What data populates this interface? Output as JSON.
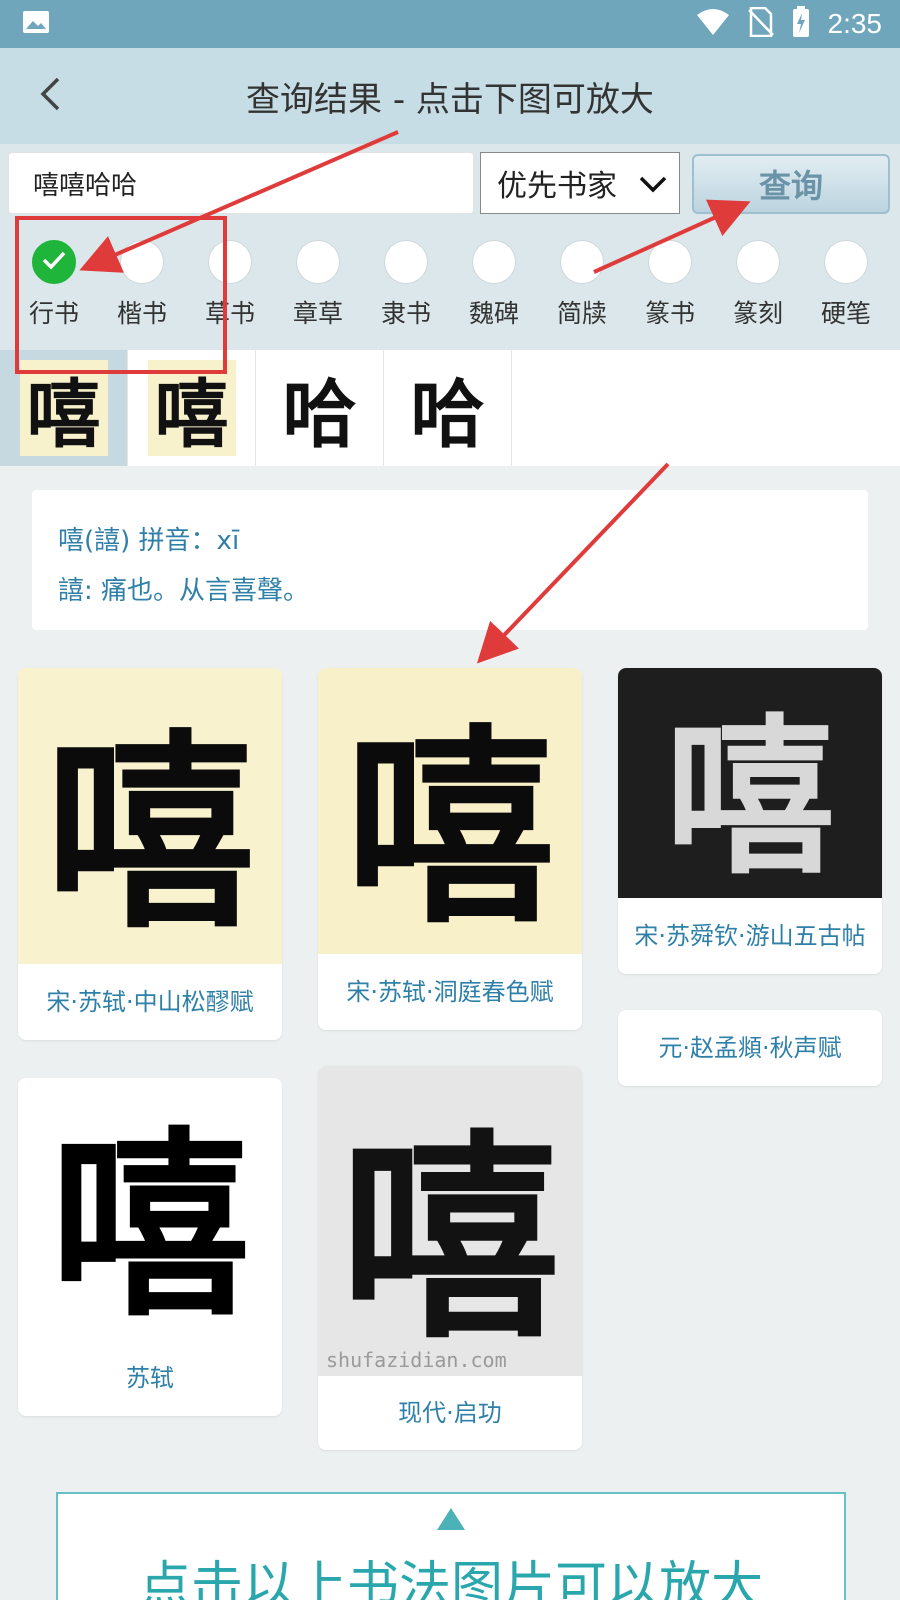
{
  "status_bar": {
    "time": "2:35",
    "icons": [
      "image-icon",
      "wifi-icon",
      "no-sim-icon",
      "battery-charging-icon"
    ]
  },
  "title_bar": {
    "title": "查询结果 - 点击下图可放大"
  },
  "search": {
    "value": "嘻嘻哈哈",
    "select_value": "优先书家",
    "button_label": "查询"
  },
  "styles": [
    {
      "label": "行书",
      "checked": true
    },
    {
      "label": "楷书",
      "checked": false
    },
    {
      "label": "草书",
      "checked": false
    },
    {
      "label": "章草",
      "checked": false
    },
    {
      "label": "隶书",
      "checked": false
    },
    {
      "label": "魏碑",
      "checked": false
    },
    {
      "label": "简牍",
      "checked": false
    },
    {
      "label": "篆书",
      "checked": false
    },
    {
      "label": "篆刻",
      "checked": false
    },
    {
      "label": "硬笔",
      "checked": false
    }
  ],
  "thumbnails": [
    {
      "char": "嘻",
      "selected": true
    },
    {
      "char": "嘻",
      "selected": false
    },
    {
      "char": "哈",
      "selected": false
    },
    {
      "char": "哈",
      "selected": false
    }
  ],
  "info": {
    "line1": "嘻(譆)    拼音：xī",
    "line2": "譆: 痛也。从言喜聲。"
  },
  "cards": [
    {
      "glyph": "嘻",
      "caption": "宋·苏轼·中山松醪赋"
    },
    {
      "glyph": "嘻",
      "caption": "宋·苏轼·洞庭春色赋"
    },
    {
      "glyph": "嘻",
      "caption": "宋·苏舜钦·游山五古帖"
    },
    {
      "glyph": "",
      "caption": "元·赵孟頫·秋声赋"
    },
    {
      "glyph": "嘻",
      "caption": "苏轼"
    },
    {
      "glyph": "嘻",
      "caption": "现代·启功",
      "watermark": "shufazidian.com"
    }
  ],
  "banner": {
    "text": "点击以上书法图片可以放大"
  },
  "colors": {
    "status_bar": "#6fa6bb",
    "title_bar": "#c6dde5",
    "accent_text": "#2f80a8",
    "check_green": "#1fb43a",
    "annotation_red": "#e03b3b"
  }
}
